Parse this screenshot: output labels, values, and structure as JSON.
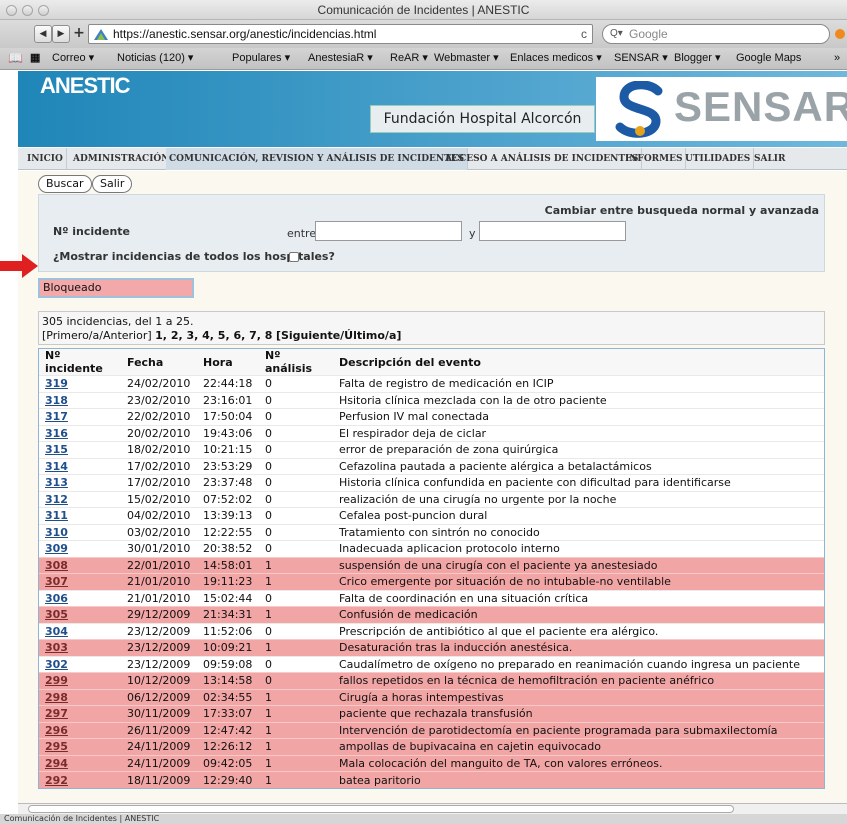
{
  "window": {
    "title": "Comunicación de Incidentes | ANESTIC"
  },
  "browser": {
    "url": "https://anestic.sensar.org/anestic/incidencias.html",
    "search_placeholder": "Google",
    "bookmarks": [
      "Correo ▾",
      "Noticias (120) ▾",
      "Populares ▾",
      "AnestesiaR ▾",
      "ReAR ▾",
      "Webmaster ▾",
      "Enlaces medicos ▾",
      "SENSAR ▾",
      "Blogger ▾",
      "Google Maps",
      "»"
    ]
  },
  "header": {
    "logo": "ANESTIC",
    "hospital": "Fundación Hospital Alcorcón",
    "brand": "SENSAR"
  },
  "menu": [
    {
      "label": "INICIO",
      "active": false
    },
    {
      "label": "ADMINISTRACIÓN",
      "active": false
    },
    {
      "label": "COMUNICACIÓN, REVISION Y ANÁLISIS DE INCIDENTES",
      "active": true
    },
    {
      "label": "ACCESO A ANÁLISIS DE INCIDENTES",
      "active": false
    },
    {
      "label": "INFORMES",
      "active": false
    },
    {
      "label": "UTILIDADES",
      "active": false
    },
    {
      "label": "SALIR",
      "active": false
    }
  ],
  "search": {
    "buscar_label": "Buscar",
    "salir_label": "Salir",
    "toggle_label": "Cambiar entre busqueda normal y avanzada",
    "field_label": "Nº incidente",
    "between_label": "entre",
    "and_label": "y",
    "all_hospitals_label": "¿Mostrar incidencias de todos los hospitales?",
    "blocked_label": "Bloqueado"
  },
  "results": {
    "summary": "305 incidencias, del 1 a 25.",
    "pager_prefix": "[Primero/a/Anterior]",
    "pages": "1, 2, 3, 4, 5, 6, 7, 8",
    "pager_suffix": "[Siguiente/Último/a]",
    "columns": [
      "Nº incidente",
      "Fecha",
      "Hora",
      "Nº análisis",
      "Descripción del evento"
    ],
    "rows": [
      {
        "id": "319",
        "fecha": "24/02/2010",
        "hora": "22:44:18",
        "analisis": "0",
        "desc": "Falta de registro de medicación en ICIP",
        "locked": false
      },
      {
        "id": "318",
        "fecha": "23/02/2010",
        "hora": "23:16:01",
        "analisis": "0",
        "desc": "Hsitoria clínica mezclada con la de otro paciente",
        "locked": false
      },
      {
        "id": "317",
        "fecha": "22/02/2010",
        "hora": "17:50:04",
        "analisis": "0",
        "desc": "Perfusion IV mal conectada",
        "locked": false
      },
      {
        "id": "316",
        "fecha": "20/02/2010",
        "hora": "19:43:06",
        "analisis": "0",
        "desc": "El respirador deja de ciclar",
        "locked": false
      },
      {
        "id": "315",
        "fecha": "18/02/2010",
        "hora": "10:21:15",
        "analisis": "0",
        "desc": "error de preparación de zona quirúrgica",
        "locked": false
      },
      {
        "id": "314",
        "fecha": "17/02/2010",
        "hora": "23:53:29",
        "analisis": "0",
        "desc": "Cefazolina pautada a paciente alérgica a betalactámicos",
        "locked": false
      },
      {
        "id": "313",
        "fecha": "17/02/2010",
        "hora": "23:37:48",
        "analisis": "0",
        "desc": "Historia clínica confundida en paciente con dificultad para identificarse",
        "locked": false
      },
      {
        "id": "312",
        "fecha": "15/02/2010",
        "hora": "07:52:02",
        "analisis": "0",
        "desc": "realización de una cirugía no urgente por la noche",
        "locked": false
      },
      {
        "id": "311",
        "fecha": "04/02/2010",
        "hora": "13:39:13",
        "analisis": "0",
        "desc": "Cefalea post-puncion dural",
        "locked": false
      },
      {
        "id": "310",
        "fecha": "03/02/2010",
        "hora": "12:22:55",
        "analisis": "0",
        "desc": "Tratamiento con sintrón no conocido",
        "locked": false
      },
      {
        "id": "309",
        "fecha": "30/01/2010",
        "hora": "20:38:52",
        "analisis": "0",
        "desc": "Inadecuada aplicacion protocolo interno",
        "locked": false
      },
      {
        "id": "308",
        "fecha": "22/01/2010",
        "hora": "14:58:01",
        "analisis": "1",
        "desc": "suspensión de una cirugía con el paciente ya anestesiado",
        "locked": true
      },
      {
        "id": "307",
        "fecha": "21/01/2010",
        "hora": "19:11:23",
        "analisis": "1",
        "desc": "Crico emergente por situación de no intubable-no ventilable",
        "locked": true
      },
      {
        "id": "306",
        "fecha": "21/01/2010",
        "hora": "15:02:44",
        "analisis": "0",
        "desc": "Falta de coordinación en una situación crítica",
        "locked": false
      },
      {
        "id": "305",
        "fecha": "29/12/2009",
        "hora": "21:34:31",
        "analisis": "1",
        "desc": "Confusión de medicación",
        "locked": true
      },
      {
        "id": "304",
        "fecha": "23/12/2009",
        "hora": "11:52:06",
        "analisis": "0",
        "desc": "Prescripción de antibiótico al que el paciente era alérgico.",
        "locked": false
      },
      {
        "id": "303",
        "fecha": "23/12/2009",
        "hora": "10:09:21",
        "analisis": "1",
        "desc": "Desaturación tras la inducción anestésica.",
        "locked": true
      },
      {
        "id": "302",
        "fecha": "23/12/2009",
        "hora": "09:59:08",
        "analisis": "0",
        "desc": "Caudalímetro de oxígeno no preparado en reanimación cuando ingresa un paciente",
        "locked": false
      },
      {
        "id": "299",
        "fecha": "10/12/2009",
        "hora": "13:14:58",
        "analisis": "0",
        "desc": "fallos repetidos en la técnica de hemofiltración en paciente anéfrico",
        "locked": true
      },
      {
        "id": "298",
        "fecha": "06/12/2009",
        "hora": "02:34:55",
        "analisis": "1",
        "desc": "Cirugía a horas intempestivas",
        "locked": true
      },
      {
        "id": "297",
        "fecha": "30/11/2009",
        "hora": "17:33:07",
        "analisis": "1",
        "desc": "paciente que rechazala transfusión",
        "locked": true
      },
      {
        "id": "296",
        "fecha": "26/11/2009",
        "hora": "12:47:42",
        "analisis": "1",
        "desc": "Intervención de parotidectomía en paciente programada para submaxilectomía",
        "locked": true
      },
      {
        "id": "295",
        "fecha": "24/11/2009",
        "hora": "12:26:12",
        "analisis": "1",
        "desc": "ampollas de bupivacaina en cajetin equivocado",
        "locked": true
      },
      {
        "id": "294",
        "fecha": "24/11/2009",
        "hora": "09:42:05",
        "analisis": "1",
        "desc": "Mala colocación del manguito de TA, con valores erróneos.",
        "locked": true
      },
      {
        "id": "292",
        "fecha": "18/11/2009",
        "hora": "12:29:40",
        "analisis": "1",
        "desc": "batea paritorio",
        "locked": true
      }
    ]
  },
  "status": {
    "text": "Comunicación de Incidentes | ANESTIC"
  },
  "colors": {
    "locked_row": "#f2a5a5",
    "header_blue": "#1f86b8",
    "link": "#1f4f8b",
    "arrow": "#e02020"
  }
}
